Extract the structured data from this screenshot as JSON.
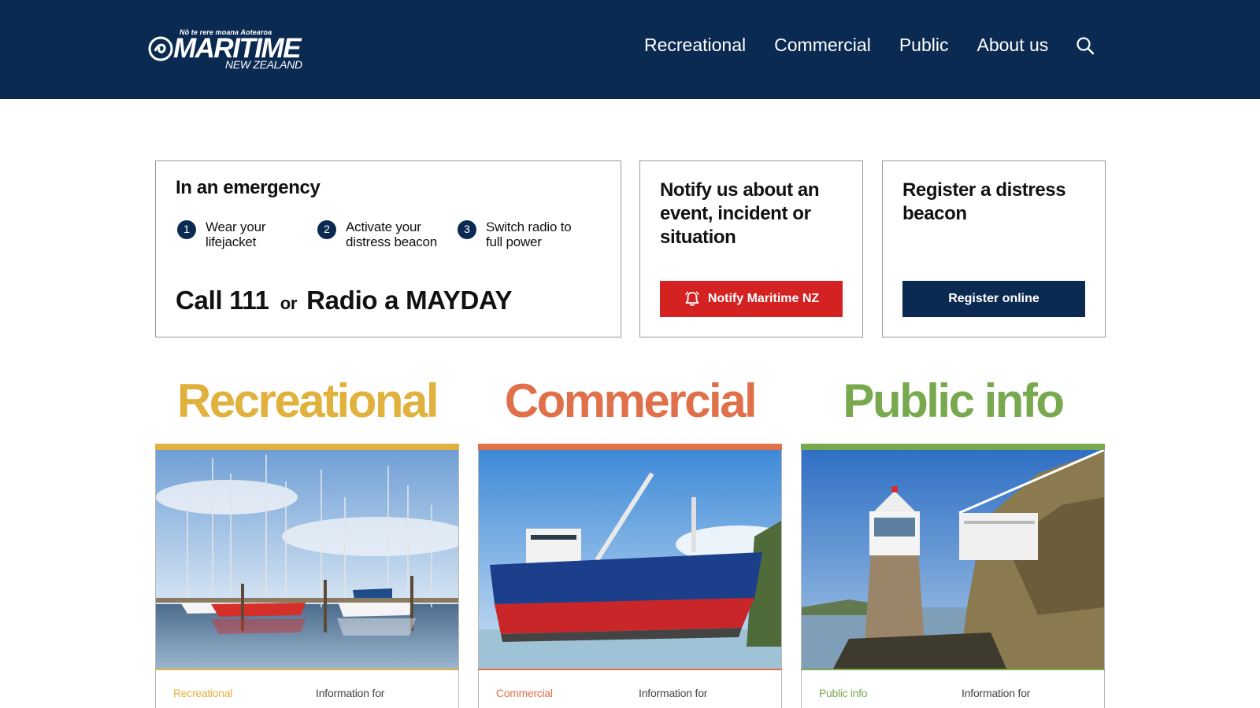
{
  "header": {
    "logo": {
      "tagline": "Nō te rere moana Aotearoa",
      "wordmark": "MARITIME",
      "subtitle": "NEW ZEALAND"
    },
    "nav": [
      {
        "label": "Recreational"
      },
      {
        "label": "Commercial"
      },
      {
        "label": "Public"
      },
      {
        "label": "About us"
      }
    ],
    "search_icon": "search-icon",
    "background": "#0b2a52"
  },
  "emergency": {
    "title": "In an emergency",
    "steps": [
      {
        "number": "1",
        "text": "Wear your lifejacket"
      },
      {
        "number": "2",
        "text": "Activate your distress beacon"
      },
      {
        "number": "3",
        "text": "Switch radio to full power"
      }
    ],
    "call": "Call 111",
    "or": "or",
    "radio": "Radio a MAYDAY"
  },
  "notify": {
    "title": "Notify us about an event, incident or situation",
    "button_label": "Notify Maritime NZ",
    "button_icon": "bell-icon",
    "button_color": "#d42121"
  },
  "beacon": {
    "title": "Register a distress beacon",
    "button_label": "Register online",
    "button_color": "#0b2a52"
  },
  "sections": [
    {
      "title": "Recreational",
      "color": "#e0b13c",
      "image": "marina-sailboats",
      "label": "Recreational",
      "info": "Information for"
    },
    {
      "title": "Commercial",
      "color": "#e0704a",
      "image": "cargo-ship",
      "label": "Commercial",
      "info": "Information for"
    },
    {
      "title": "Public info",
      "color": "#78a94f",
      "image": "lighthouse",
      "label": "Public info",
      "info": "Information for"
    }
  ]
}
